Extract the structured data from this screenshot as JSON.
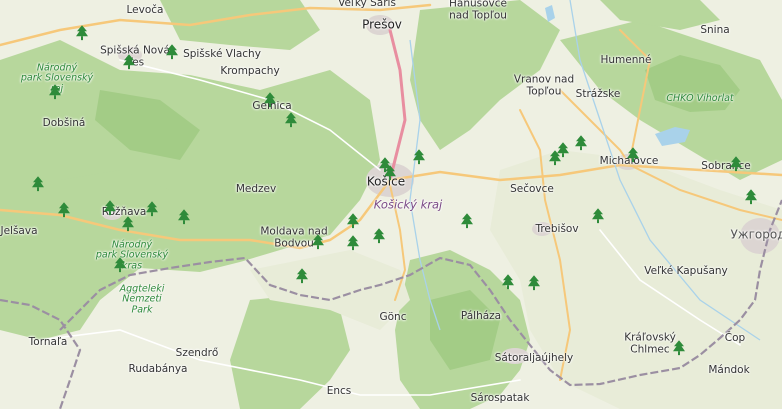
{
  "map": {
    "colors": {
      "land": "#eef0e2",
      "forest": "#b7d79c",
      "forest_dark": "#a3cc86",
      "urban": "#dcd5d2",
      "water": "#a9d2ea",
      "motorway": "#e88ea0",
      "primary": "#f6c87a",
      "border": "#9b8fa2",
      "tree_marker": "#2e8b3a"
    },
    "labels": {
      "levoca": "Levoča",
      "velky_saris": "Veľký Šariš",
      "presov": "Prešov",
      "hanusovce": "Hanušovce\nnad Topľou",
      "snina": "Snina",
      "spisska_nova_ves": "Spišská Nová\nVes",
      "spisske_vlachy": "Spišské Vlachy",
      "krompachy": "Krompachy",
      "np_slovensky_raj": "Národný\npark Slovenský\nraj",
      "vranov": "Vranov nad\nTopľou",
      "humenne": "Humenné",
      "strazske": "Strážske",
      "chko_vihorlat": "CHKO Vihorlat",
      "dobsina": "Dobšiná",
      "gelnica": "Gelnica",
      "michalovce": "Michalovce",
      "sobrance": "Sobrance",
      "kosice": "Košice",
      "secovce": "Sečovce",
      "medzev": "Medzev",
      "kosicky_kraj": "Košický kraj",
      "roznava": "Rožňava",
      "jelsava": "Jelšava",
      "moldava": "Moldava nad\nBodvou",
      "trebisov": "Trebišov",
      "uzhhorod": "Ужгород",
      "np_slovensky_kras": "Národný\npark Slovenský\nkras",
      "velke_kapusany": "Veľké Kapušany",
      "aggteleki": "Aggteleki\nNemzeti\nPark",
      "gonc": "Gönc",
      "palhaza": "Pálháza",
      "tornala": "Tornaľa",
      "kralovsky": "Kráľovský\nChlmec",
      "csop": "Čop",
      "szendro": "Szendrő",
      "satoraljaujhely": "Sátoraljaújhely",
      "rudabanya": "Rudabánya",
      "mandok": "Mándok",
      "encs": "Encs",
      "sarospatak": "Sárospatak"
    },
    "marker_icon": "tree-marker-icon",
    "marker_count": 32
  }
}
